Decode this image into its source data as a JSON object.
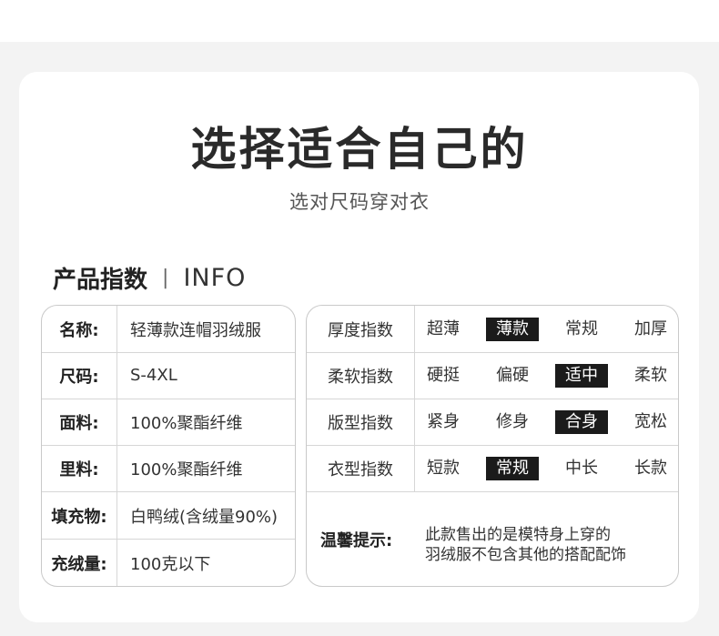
{
  "title": "选择适合自己的",
  "subtitle": "选对尺码穿对衣",
  "section": {
    "cn": "产品指数",
    "sep": "|",
    "en": "INFO"
  },
  "specs": [
    {
      "key": "名称:",
      "value": "轻薄款连帽羽绒服"
    },
    {
      "key": "尺码:",
      "value": "S-4XL"
    },
    {
      "key": "面料:",
      "value": "100%聚酯纤维"
    },
    {
      "key": "里料:",
      "value": "100%聚酯纤维"
    },
    {
      "key": "填充物:",
      "value": "白鸭绒(含绒量90%)"
    },
    {
      "key": "充绒量:",
      "value": "100克以下"
    }
  ],
  "indices": [
    {
      "key": "厚度指数",
      "options": [
        "超薄",
        "薄款",
        "常规",
        "加厚"
      ],
      "selected": "薄款"
    },
    {
      "key": "柔软指数",
      "options": [
        "硬挺",
        "偏硬",
        "适中",
        "柔软"
      ],
      "selected": "适中"
    },
    {
      "key": "版型指数",
      "options": [
        "紧身",
        "修身",
        "合身",
        "宽松"
      ],
      "selected": "合身"
    },
    {
      "key": "衣型指数",
      "options": [
        "短款",
        "常规",
        "中长",
        "长款"
      ],
      "selected": "常规"
    }
  ],
  "note": {
    "key": "温馨提示:",
    "line1": "此款售出的是模特身上穿的",
    "line2": "羽绒服不包含其他的搭配配饰"
  },
  "colors": {
    "selected_bg": "#1b1b1b",
    "selected_text": "#ffffff",
    "border": "#c9c9c9",
    "page_bg": "#f3f3f3"
  }
}
